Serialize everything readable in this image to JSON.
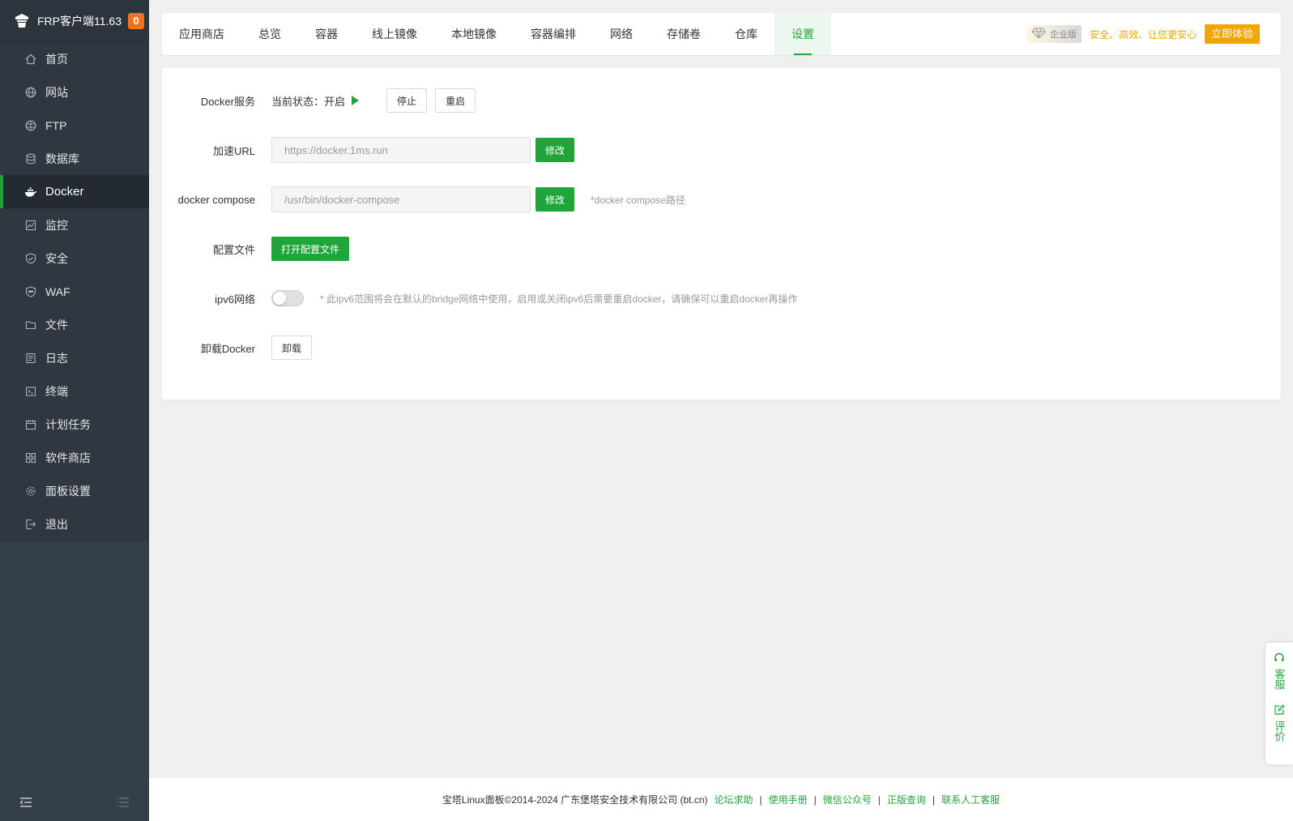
{
  "sidebar": {
    "app_title": "FRP客户端11.63",
    "badge_count": "0",
    "items": [
      {
        "label": "首页",
        "icon": "home-icon"
      },
      {
        "label": "网站",
        "icon": "globe-icon"
      },
      {
        "label": "FTP",
        "icon": "ftp-globe-icon"
      },
      {
        "label": "数据库",
        "icon": "database-icon"
      },
      {
        "label": "Docker",
        "icon": "docker-whale-icon"
      },
      {
        "label": "监控",
        "icon": "monitor-chart-icon"
      },
      {
        "label": "安全",
        "icon": "shield-icon"
      },
      {
        "label": "WAF",
        "icon": "waf-shield-icon"
      },
      {
        "label": "文件",
        "icon": "folder-icon"
      },
      {
        "label": "日志",
        "icon": "log-icon"
      },
      {
        "label": "终端",
        "icon": "terminal-icon"
      },
      {
        "label": "计划任务",
        "icon": "calendar-icon"
      },
      {
        "label": "软件商店",
        "icon": "apps-grid-icon"
      },
      {
        "label": "面板设置",
        "icon": "gear-icon"
      },
      {
        "label": "退出",
        "icon": "logout-icon"
      }
    ],
    "active_item": "Docker"
  },
  "tabs": [
    {
      "label": "应用商店"
    },
    {
      "label": "总览"
    },
    {
      "label": "容器"
    },
    {
      "label": "线上镜像"
    },
    {
      "label": "本地镜像"
    },
    {
      "label": "容器编排"
    },
    {
      "label": "网络"
    },
    {
      "label": "存储卷"
    },
    {
      "label": "仓库"
    },
    {
      "label": "设置"
    }
  ],
  "active_tab": "设置",
  "promo": {
    "edition": "企业版",
    "slogan": "安全、高效、让您更安心",
    "button": "立即体验"
  },
  "settings": {
    "docker_service": {
      "label": "Docker服务",
      "status": "当前状态：开启",
      "stop_button": "停止",
      "restart_button": "重启"
    },
    "mirror_url": {
      "label": "加速URL",
      "placeholder": "https://docker.1ms.run",
      "button": "修改"
    },
    "compose": {
      "label": "docker compose",
      "placeholder": "/usr/bin/docker-compose",
      "button": "修改",
      "hint": "*docker compose路径"
    },
    "config_file": {
      "label": "配置文件",
      "button": "打开配置文件"
    },
    "ipv6": {
      "label": "ipv6网络",
      "enabled": false,
      "hint": "* 此ipv6范围将会在默认的bridge网络中使用，启用或关闭ipv6后需要重启docker，请确保可以重启docker再操作"
    },
    "uninstall": {
      "label": "卸载Docker",
      "button": "卸载"
    }
  },
  "footer": {
    "copyright": "宝塔Linux面板©2014-2024 广东堡塔安全技术有限公司 (bt.cn)",
    "links": [
      "论坛求助",
      "使用手册",
      "微信公众号",
      "正版查询",
      "联系人工客服"
    ],
    "separator": "|"
  },
  "float": {
    "service": "客服",
    "review": "评价"
  },
  "colors": {
    "accent": "#20a53a",
    "sidebar": "#353f4a",
    "badge": "#f0731c",
    "promo": "#f0a500"
  }
}
